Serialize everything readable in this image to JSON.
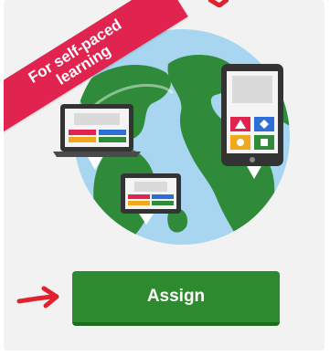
{
  "ribbon": {
    "line1": "For self-paced",
    "line2": "learning"
  },
  "assign_button": {
    "label": "Assign"
  },
  "colors": {
    "ribbon": "#e0244f",
    "button": "#2e8a2f",
    "button_shadow": "#1f6b20",
    "arrow": "#e0212f",
    "ocean": "#a8d5ef",
    "land": "#2f8b3a",
    "card_bg": "#f2f2f2"
  },
  "icons": {
    "globe": "globe-icon",
    "laptop": "laptop-icon",
    "tablet": "tablet-icon",
    "monitor": "monitor-icon",
    "arrow": "red-arrow-icon"
  }
}
